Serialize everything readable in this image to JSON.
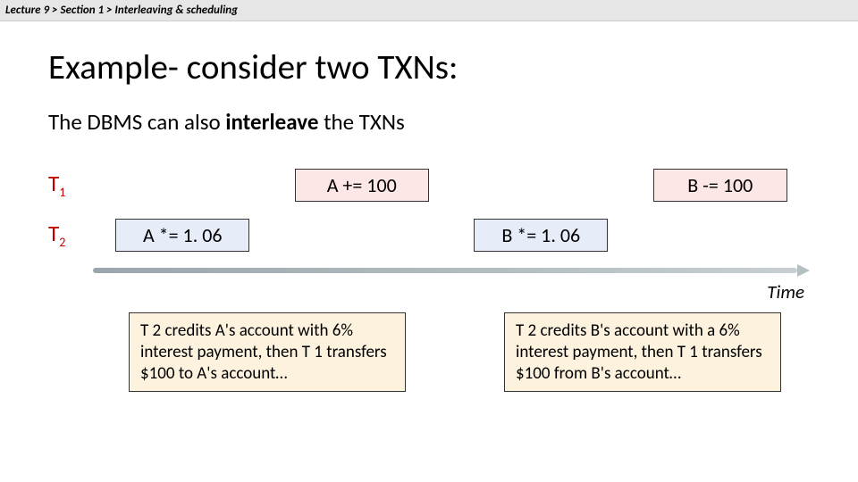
{
  "breadcrumb": "Lecture 9 > Section 1 > Interleaving & scheduling",
  "title": "Example- consider two TXNs:",
  "subtitle_pre": "The DBMS can also ",
  "subtitle_bold": "interleave",
  "subtitle_post": " the TXNs",
  "t1_label": "T",
  "t1_sub": "1",
  "t2_label": "T",
  "t2_sub": "2",
  "ops": {
    "a_plus": "A += 100",
    "b_minus": "B -= 100",
    "a_mul": "A *= 1. 06",
    "b_mul": "B *= 1. 06"
  },
  "time_label": "Time",
  "note_left": "T 2 credits A's account with 6% interest payment, then T 1 transfers $100 to A's account…",
  "note_right": "T 2 credits B's account with a 6% interest payment, then T 1 transfers $100 from B's account…"
}
